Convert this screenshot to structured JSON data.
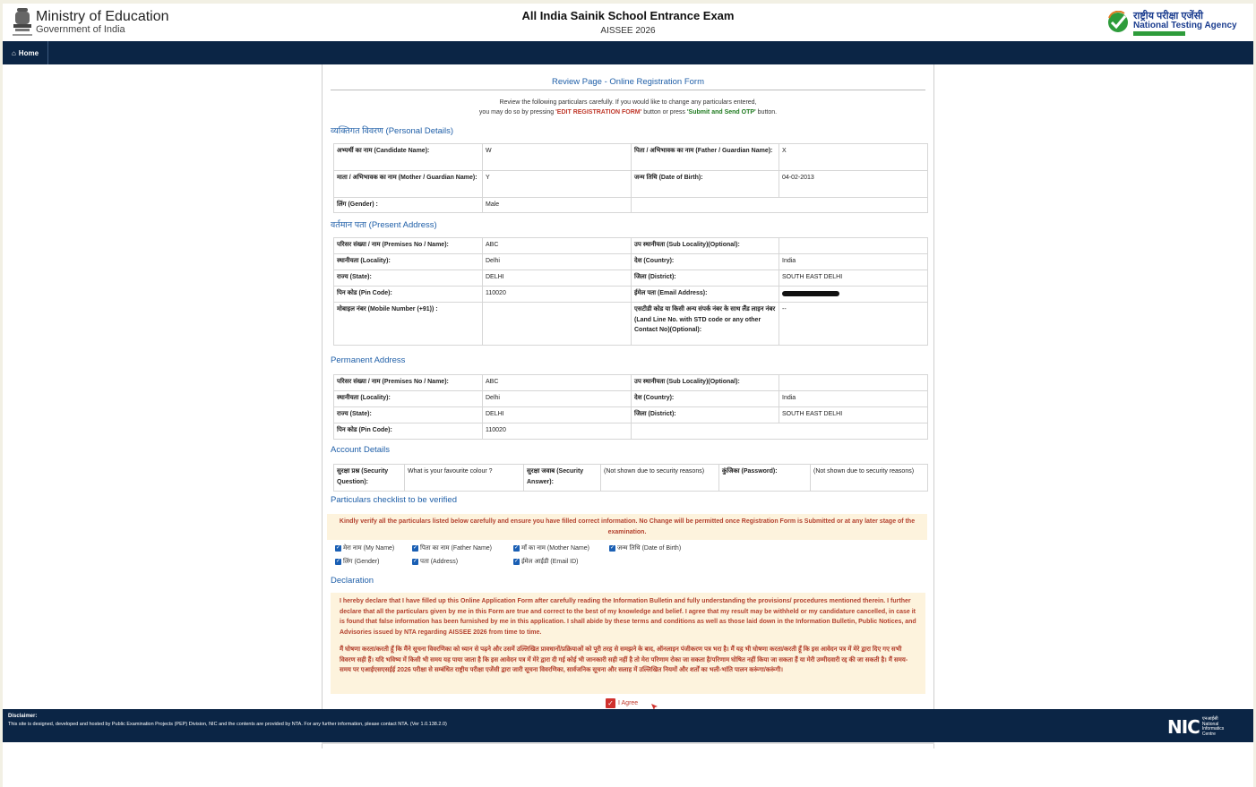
{
  "header": {
    "ministry_title": "Ministry of Education",
    "ministry_sub": "Government of India",
    "exam_title": "All India Sainik School Entrance Exam",
    "exam_code": "AISSEE 2026",
    "nta_hindi": "राष्ट्रीय परीक्षा एजेंसी",
    "nta_english": "National Testing Agency"
  },
  "nav": {
    "home": "Home"
  },
  "review": {
    "title": "Review Page - Online Registration Form",
    "instr_line1": "Review the following particulars carefully. If you would like to change any particulars entered,",
    "instr_pre": "you may do so by pressing ",
    "instr_edit": "'EDIT REGISTRATION FORM'",
    "instr_mid": " button or press ",
    "instr_submit": "'Submit and Send OTP'",
    "instr_post": " button."
  },
  "personal": {
    "heading": "व्यक्तिगत विवरण (Personal Details)",
    "candidate_label": "अभ्यर्थी का नाम (Candidate Name):",
    "candidate_value": "W",
    "father_label": "पिता / अभिभावक का नाम (Father / Guardian Name):",
    "father_value": "X",
    "mother_label": "माता / अभिभावक का नाम (Mother / Guardian Name):",
    "mother_value": "Y",
    "dob_label": "जन्म तिथि (Date of Birth):",
    "dob_value": "04-02-2013",
    "gender_label": "लिंग (Gender) :",
    "gender_value": "Male"
  },
  "present": {
    "heading": "वर्तमान पता (Present Address)",
    "premises_label": "परिसर संख्या / नाम (Premises No / Name):",
    "premises_value": "ABC",
    "sublocality_label": "उप स्थानीयता (Sub Locality)(Optional):",
    "sublocality_value": "",
    "locality_label": "स्थानीयता (Locality):",
    "locality_value": "Delhi",
    "country_label": "देश (Country):",
    "country_value": "India",
    "state_label": "राज्य (State):",
    "state_value": "DELHI",
    "district_label": "जिला (District):",
    "district_value": "SOUTH EAST DELHI",
    "pin_label": "पिन कोड (Pin Code):",
    "pin_value": "110020",
    "email_label": "ईमेल पता (Email Address):",
    "mobile_label": "मोबाइल नंबर (Mobile Number (+91)) :",
    "mobile_value": "",
    "landline_label": "एसटीडी कोड या किसी अन्य संपर्क नंबर के साथ लैंड लाइन नंबर (Land Line No. with STD code or any other Contact No)(Optional):",
    "landline_value": "--"
  },
  "permanent": {
    "heading": "Permanent Address",
    "premises_label": "परिसर संख्या / नाम (Premises No / Name):",
    "premises_value": "ABC",
    "sublocality_label": "उप स्थानीयता (Sub Locality)(Optional):",
    "sublocality_value": "",
    "locality_label": "स्थानीयता (Locality):",
    "locality_value": "Delhi",
    "country_label": "देश (Country):",
    "country_value": "India",
    "state_label": "राज्य (State):",
    "state_value": "DELHI",
    "district_label": "जिला (District):",
    "district_value": "SOUTH EAST DELHI",
    "pin_label": "पिन कोड (Pin Code):",
    "pin_value": "110020"
  },
  "account": {
    "heading": "Account Details",
    "secq_label": "सुरक्षा प्रश्न (Security Question):",
    "secq_value": "What is your favourite colour ?",
    "seca_label": "सुरक्षा जवाब (Security Answer):",
    "seca_value": "(Not shown due to security reasons)",
    "pwd_label": "कुंजिका (Password):",
    "pwd_value": "(Not shown due to security reasons)"
  },
  "checklist": {
    "heading": "Particulars checklist to be verified",
    "warning": "Kindly verify all the particulars listed below carefully and ensure you have filled correct information. No Change will be permitted once Registration Form is Submitted or at any later stage of the examination.",
    "items": [
      "मेरा नाम (My Name)",
      "पिता का नाम (Father Name)",
      "माँ का नाम (Mother Name)",
      "जन्म तिथि (Date of Birth)",
      "लिंग (Gender)",
      "पता (Address)",
      "ईमेल आईडी (Email ID)"
    ]
  },
  "declaration": {
    "heading": "Declaration",
    "english": "I hereby declare that I have filled up this Online Application Form after carefully reading the Information Bulletin and fully understanding the provisions/ procedures mentioned therein. I further declare that all the particulars given by me in this Form are true and correct to the best of my knowledge and belief. I agree that my result may be withheld or my candidature cancelled, in case it is found that false information has been furnished by me in this application. I shall abide by these terms and conditions as well as those laid down in the Information Bulletin, Public Notices, and Advisories issued by NTA regarding AISSEE 2026 from time to time.",
    "hindi": "मैं घोषणा करता/करती हूँ कि मैंने सूचना विवरणिका को ध्यान से पढ़ने और उसमें उल्लिखित प्रावधानों/प्रक्रियाओं को पूरी तरह से समझने के बाद, ऑनलाइन पंजीकरण पत्र भरा है। मैं यह भी घोषणा करता/करती हूँ कि इस आवेदन पत्र में मेरे द्वारा दिए गए सभी विवरण सही हैं। यदि भविष्य में किसी भी समय यह पाया जाता है कि इस आवेदन पत्र में मेरे द्वारा दी गई कोई भी जानकारी सही नहीं है तो मेरा परिणाम रोका जा सकता है/परिणाम घोषित नहीं किया जा सकता हैं या मेरी उम्मीदवारी रद्द की जा सकती है। मैं समय-समय पर एआईएसएसईई 2026 परीक्षा से सम्बंधित राष्ट्रीय परीक्षा एजेंसी द्वारा जारी सूचना विवरणिका, सार्वजनिक सूचना और सलाह में उल्लिखित नियमों और शर्तों का भली-भांति पालन करूंगा/करूंगी।",
    "agree_label": "I Agree"
  },
  "footer": {
    "disclaimer_head": "Disclaimer:",
    "disclaimer_text": "This site is designed, developed and hosted by Public Examination Projects (PEP) Division, NIC and the contents are provided by NTA. For any further information, please contact NTA. (Ver 1.0.138.2.0)",
    "nic_mark": "NIC",
    "nic_hindi": "एनआईसी",
    "nic_l1": "National",
    "nic_l2": "Informatics",
    "nic_l3": "Centre"
  },
  "colors": {
    "nav_bg": "#0b2545",
    "heading_blue": "#1f5fa8",
    "alert_red": "#d0312d",
    "warn_bg": "#fdf3dd"
  }
}
